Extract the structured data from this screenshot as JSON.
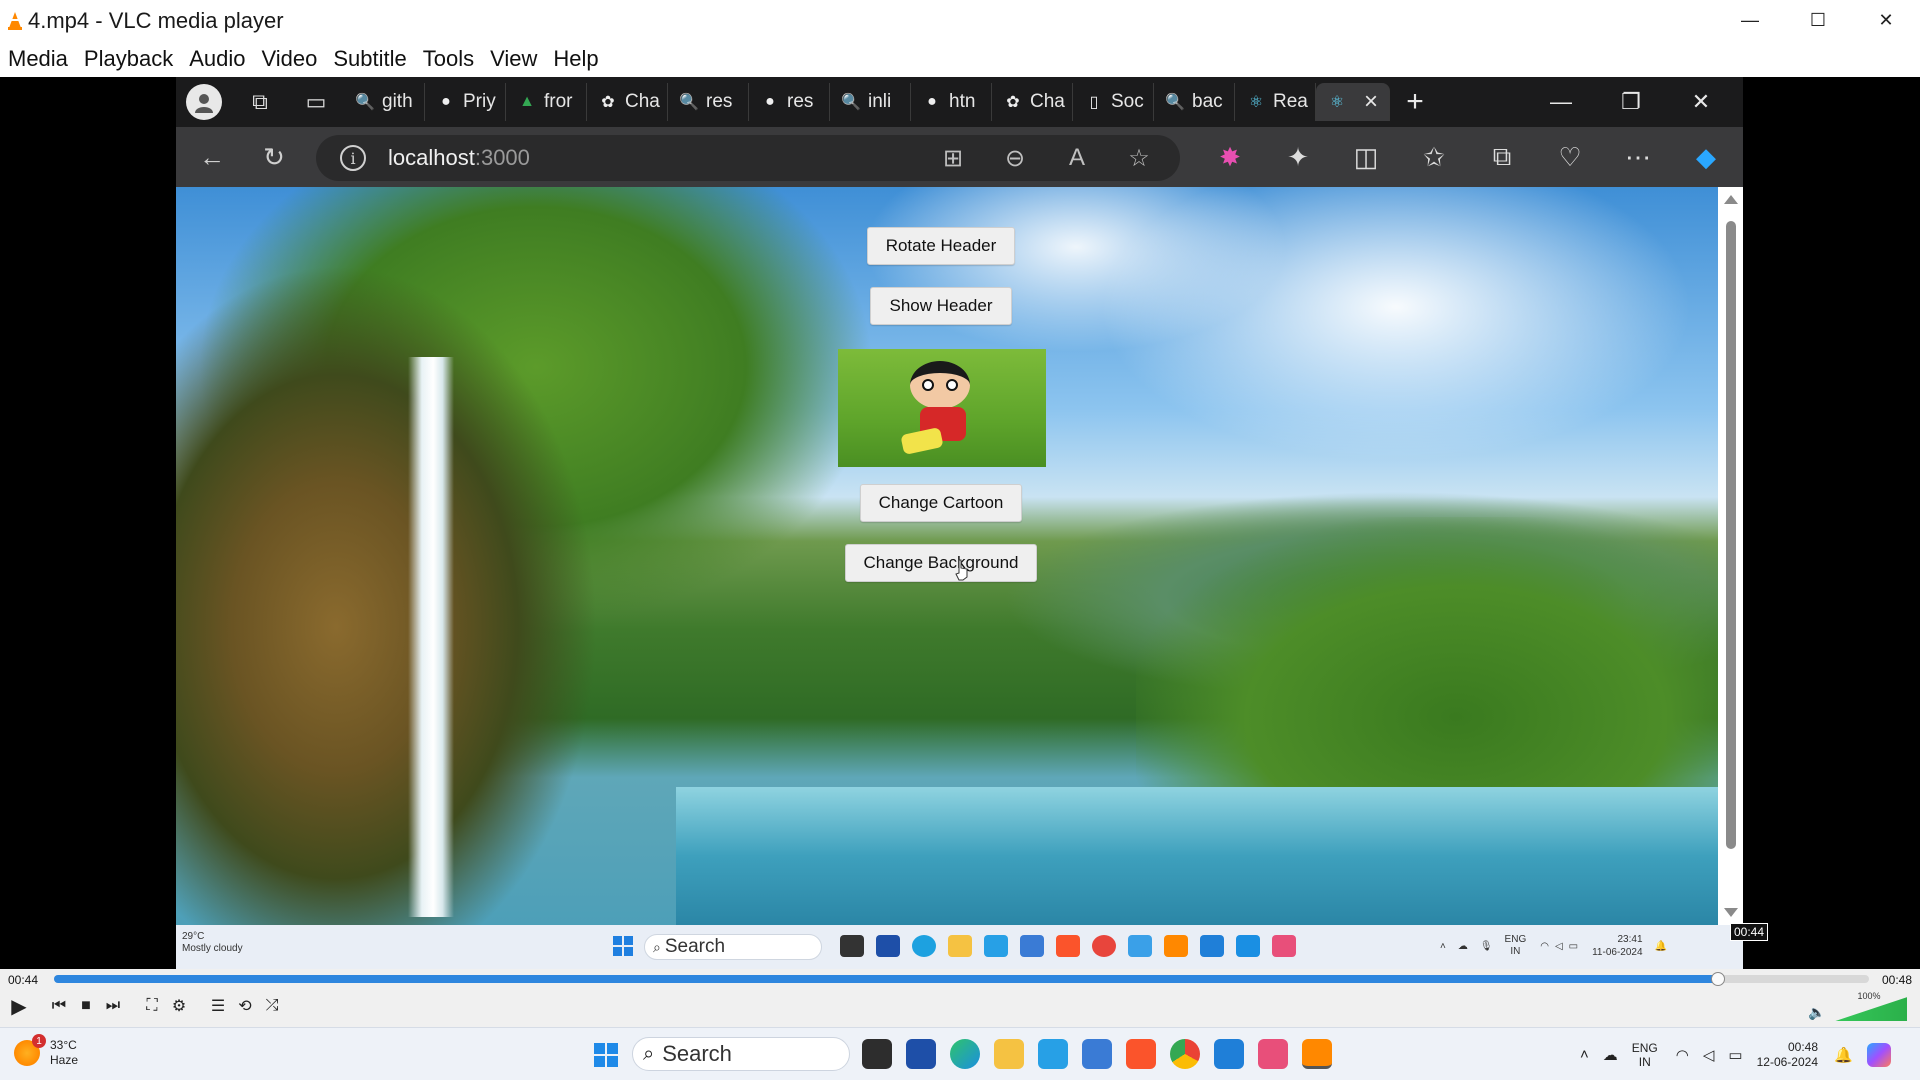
{
  "vlc": {
    "window_title": "4.mp4 - VLC media player",
    "window_controls": {
      "minimize": "—",
      "maximize": "☐",
      "close": "✕"
    },
    "menu": [
      "Media",
      "Playback",
      "Audio",
      "Video",
      "Subtitle",
      "Tools",
      "View",
      "Help"
    ],
    "time_elapsed": "00:44",
    "time_total": "00:48",
    "time_badge": "00:44",
    "progress": 0.9167,
    "volume_label": "100%",
    "volume_level": 1.0
  },
  "browser": {
    "tabs": [
      {
        "label": "gith",
        "icon": "search-icon"
      },
      {
        "label": "Priy",
        "icon": "github-icon"
      },
      {
        "label": "fror",
        "icon": "google-drive-icon"
      },
      {
        "label": "Cha",
        "icon": "chatgpt-icon"
      },
      {
        "label": "res",
        "icon": "search-icon"
      },
      {
        "label": "res",
        "icon": "github-icon"
      },
      {
        "label": "inli",
        "icon": "search-icon"
      },
      {
        "label": "htn",
        "icon": "github-icon"
      },
      {
        "label": "Cha",
        "icon": "chatgpt-icon"
      },
      {
        "label": "Soc",
        "icon": "document-icon"
      },
      {
        "label": "bac",
        "icon": "search-icon"
      },
      {
        "label": "Rea",
        "icon": "react-icon"
      }
    ],
    "url_host": "localhost",
    "url_port": ":3000"
  },
  "webpage": {
    "rotate_header_label": "Rotate Header",
    "show_header_label": "Show Header",
    "change_cartoon_label": "Change Cartoon",
    "change_background_label": "Change Background"
  },
  "inner_taskbar": {
    "weather_temp": "29°C",
    "weather_desc": "Mostly cloudy",
    "search_label": "Search",
    "lang_1": "ENG",
    "lang_2": "IN",
    "time": "23:41",
    "date": "11-06-2024"
  },
  "taskbar": {
    "weather_temp": "33°C",
    "weather_desc": "Haze",
    "weather_badge": "1",
    "search_label": "Search",
    "lang_1": "ENG",
    "lang_2": "IN",
    "time": "00:48",
    "date": "12-06-2024"
  },
  "colors": {
    "accent": "#2e86de",
    "vlc_orange": "#ff8800",
    "browser_dark": "#1b1b1c"
  }
}
